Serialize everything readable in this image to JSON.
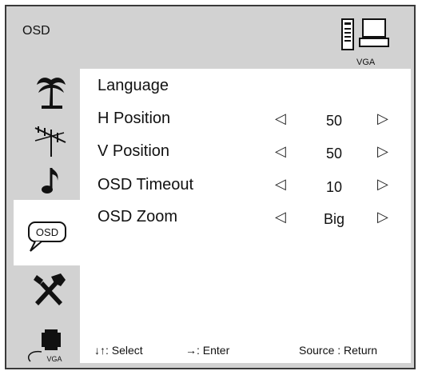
{
  "header": {
    "title": "OSD",
    "source_label": "VGA"
  },
  "menu": [
    {
      "label": "Language"
    },
    {
      "label": "H Position",
      "value": "50"
    },
    {
      "label": "V Position",
      "value": "50"
    },
    {
      "label": "OSD Timeout",
      "value": "10"
    },
    {
      "label": "OSD Zoom",
      "value": "Big"
    }
  ],
  "sidebar": {
    "osd_icon_text": "OSD",
    "vga_icon_text": "VGA"
  },
  "footer": {
    "select": "↓↑: Select",
    "enter": "→: Enter",
    "return": "Source : Return"
  },
  "icons": {
    "arrow_left": "◁",
    "arrow_right": "▷"
  }
}
